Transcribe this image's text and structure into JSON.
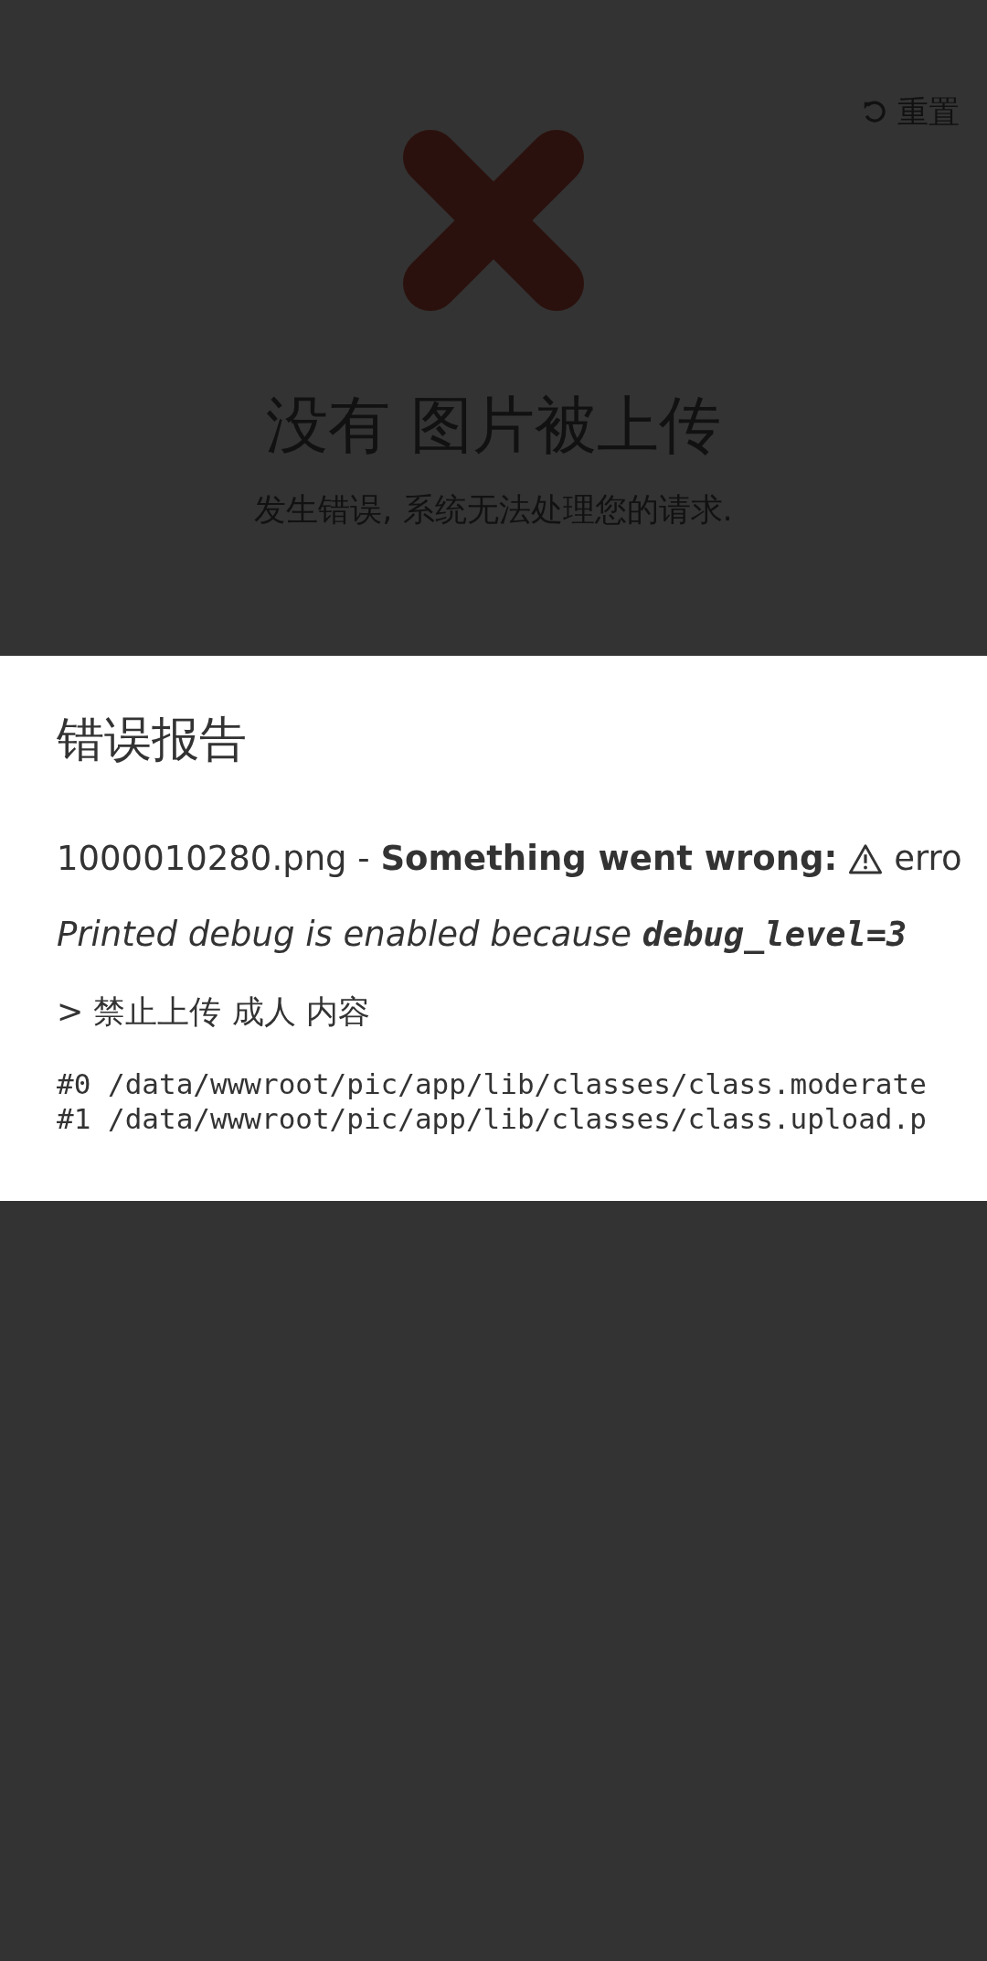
{
  "reset_button": {
    "label": "重置"
  },
  "status": {
    "title": "没有 图片被上传",
    "message": "发生错误, 系统无法处理您的请求."
  },
  "error_report": {
    "title": "错误报告",
    "summary": "1000010280.png - **Something went wrong:**",
    "summary_tail": "erro",
    "debug_note": "Printed debug is enabled because **debug_level=3**",
    "reason": "> 禁止上传 成人 内容",
    "trace": [
      "#0 /data/wwwroot/pic/app/lib/classes/class.moderate",
      "#1 /data/wwwroot/pic/app/lib/classes/class.upload.p"
    ]
  }
}
